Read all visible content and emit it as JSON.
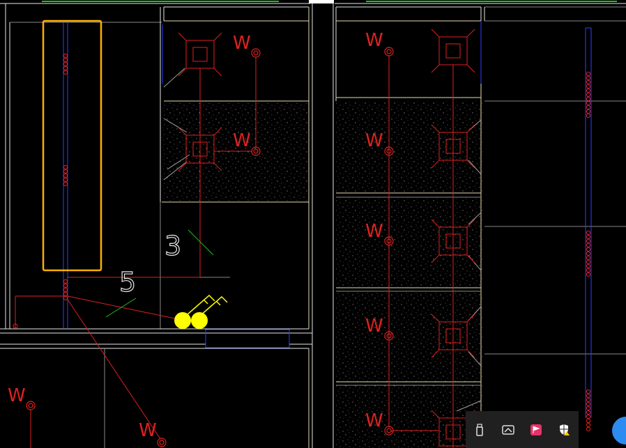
{
  "labels": {
    "w": "W",
    "dim_3": "3",
    "dim_5": "5"
  },
  "colors": {
    "background": "#000000",
    "pipe_red": "#e02020",
    "wall_white": "#e8e8e8",
    "wall_cream": "#e8dcb0",
    "blue_line": "#3040ff",
    "selection_orange": "#ffb000",
    "dimension_green": "#20c020",
    "marker_yellow": "#ffff00",
    "tray_bg": "#202020",
    "fab_blue": "#2d8cf0"
  },
  "tray": {
    "icons": [
      "usb-drive-icon",
      "screen-capture-icon",
      "app-flag-icon",
      "security-shield-icon"
    ]
  }
}
